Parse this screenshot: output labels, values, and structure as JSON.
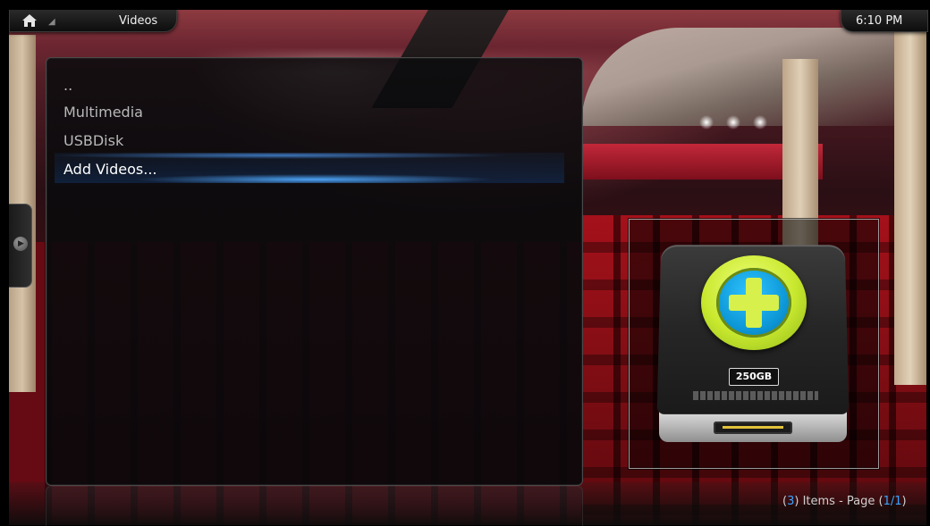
{
  "header": {
    "title": "Videos",
    "clock": "6:10 PM"
  },
  "list": {
    "items": [
      {
        "label": ".."
      },
      {
        "label": "Multimedia"
      },
      {
        "label": "USBDisk"
      },
      {
        "label": "Add Videos..."
      }
    ],
    "focused_index": 3
  },
  "thumbnail": {
    "capacity_label": "250GB",
    "icon": "add-drive-icon"
  },
  "footer": {
    "items_count": "3",
    "items_text": " Items - Page (",
    "page": "1/1",
    "close_paren": ")",
    "open_paren": "("
  },
  "colors": {
    "accent": "#3aa3ff",
    "focus_glow": "#50aaff"
  }
}
